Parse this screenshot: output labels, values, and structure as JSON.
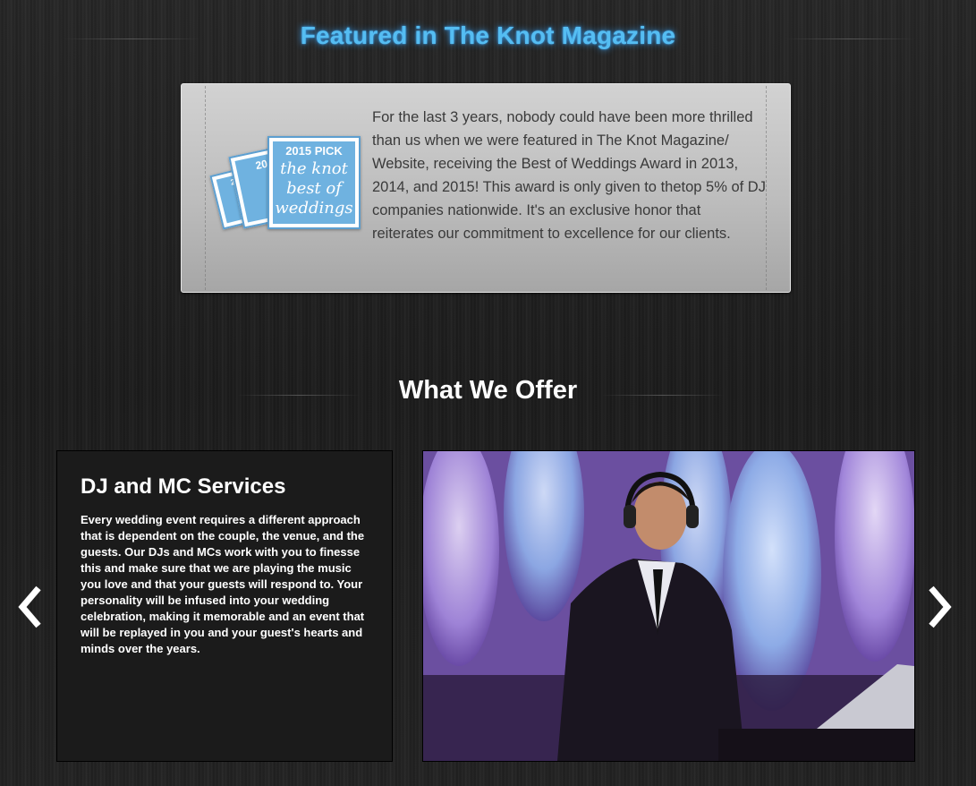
{
  "featured": {
    "title": "Featured in The Knot Magazine",
    "body": "For the last 3 years, nobody could have been more thrilled than us when we were featured in The Knot Magazine/ Website, receiving the Best of Weddings Award in 2013, 2014, and 2015! This award is only given to thetop 5% of DJ companies nationwide. It's an exclusive honor that reiterates our commitment to excellence for our clients.",
    "badges": [
      {
        "year": "2013"
      },
      {
        "year": "2014"
      },
      {
        "year": "2015 PICK",
        "line1": "the knot",
        "line2": "best of",
        "line3": "weddings"
      }
    ]
  },
  "offer": {
    "title": "What We Offer",
    "service_title": "DJ and MC Services",
    "service_body": "Every wedding event requires a different approach that is dependent on the couple, the venue, and the guests. Our DJs and MCs work with you to finesse this and make sure that we are playing the music you love and that your guests will respond to. Your personality will be infused into your wedding celebration, making it memorable and an event that will be replayed in you and your guest's hearts and minds over the years."
  },
  "nav": {
    "prev_icon": "chevron-left-icon",
    "next_icon": "chevron-right-icon"
  },
  "colors": {
    "accent": "#55bdf2",
    "badge": "#6fb2e0",
    "card": "#c4c4c4"
  }
}
